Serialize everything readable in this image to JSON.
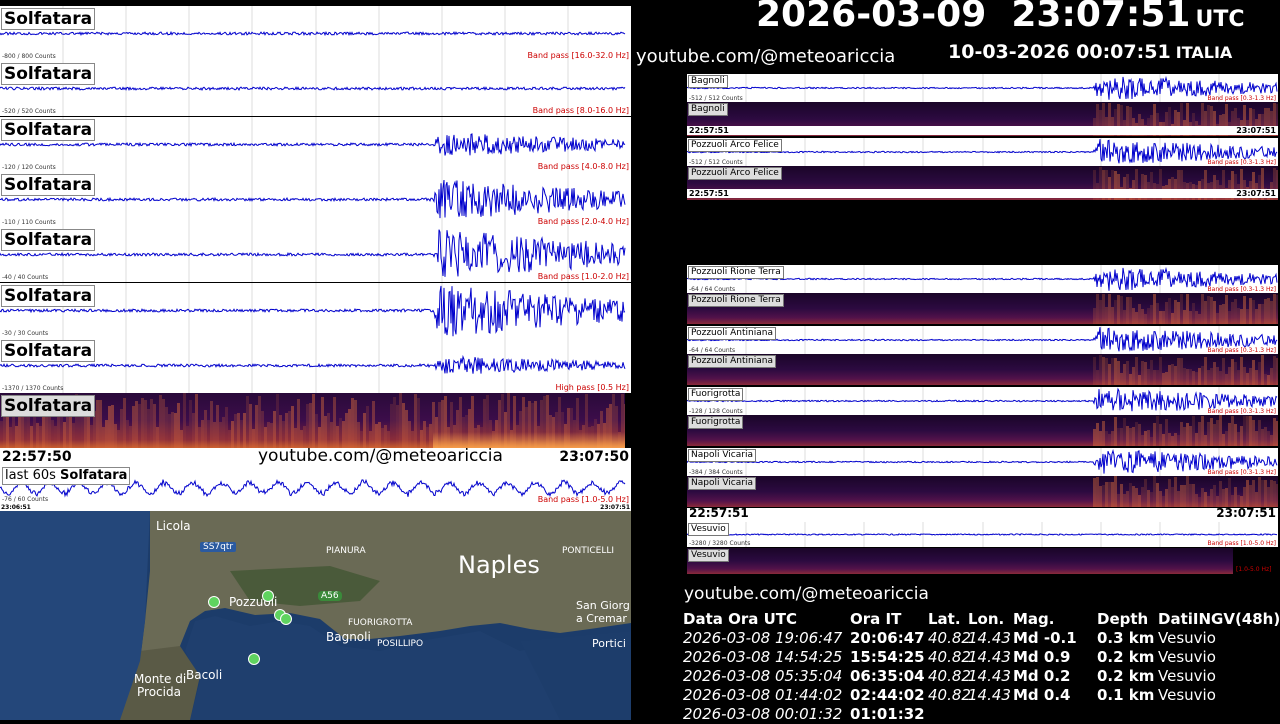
{
  "header": {
    "utc_datetime": "2026-03-09  23:07:51",
    "utc_label": "UTC",
    "local_datetime": "10-03-2026 00:07:51",
    "local_label": "ITALIA",
    "channel": "youtube.com/@meteoariccia"
  },
  "left_panels": [
    {
      "station": "Solfatara",
      "counts": "-800 / 800 Counts",
      "filter": "Band pass [16.0-32.0 Hz]",
      "type": "trace",
      "amp": 0.08
    },
    {
      "station": "Solfatara",
      "counts": "-520 / 520 Counts",
      "filter": "Band pass [8.0-16.0 Hz]",
      "type": "trace",
      "amp": 0.08
    },
    {
      "station": "Solfatara",
      "counts": "-120 / 120 Counts",
      "filter": "Band pass [4.0-8.0 Hz]",
      "type": "trace",
      "amp": 0.45
    },
    {
      "station": "Solfatara",
      "counts": "-110 / 110 Counts",
      "filter": "Band pass [2.0-4.0 Hz]",
      "type": "trace",
      "amp": 0.75
    },
    {
      "station": "Solfatara",
      "counts": "-40 / 40 Counts",
      "filter": "Band pass [1.0-2.0 Hz]",
      "type": "trace",
      "amp": 0.95
    },
    {
      "station": "Solfatara",
      "counts": "-30 / 30 Counts",
      "filter": "",
      "type": "trace",
      "amp": 1.0
    },
    {
      "station": "Solfatara",
      "counts": "-1370 / 1370 Counts",
      "filter": "High pass [0.5 Hz]",
      "type": "trace",
      "amp": 0.35
    },
    {
      "station": "Solfatara",
      "counts": "",
      "filter": "",
      "type": "spectrogram",
      "amp": 0
    }
  ],
  "left_time": {
    "start": "22:57:50",
    "end": "23:07:50",
    "channel": "youtube.com/@meteoariccia"
  },
  "last60": {
    "label": "last 60s",
    "station": "Solfatara",
    "counts": "-76 / 60 Counts",
    "filter": "Band pass [1.0-5.0 Hz]",
    "start": "23:06:51",
    "end": "23:07:51"
  },
  "map": {
    "labels": {
      "licola": "Licola",
      "ss7qtr": "SS7qtr",
      "pianura": "PIANURA",
      "ponticelli": "PONTICELLI",
      "naples": "Naples",
      "pozzuoli": "Pozzuoli",
      "a56": "A56",
      "fuorigrotta": "FUORIGROTTA",
      "san_giorgio": "San Giorg",
      "cremano": "a Cremar",
      "bagnoli": "Bagnoli",
      "posillipo": "POSILLIPO",
      "portici": "Portici",
      "bacoli": "Bacoli",
      "monte_di": "Monte di",
      "procida": "Procida"
    }
  },
  "right_group1": {
    "panels": [
      {
        "station": "Bagnoli",
        "counts": "-512 / 512 Counts",
        "filter": "Band pass [0.3-1.3 Hz]"
      },
      {
        "station": "Pozzuoli Arco Felice",
        "counts": "-512 / 512 Counts",
        "filter": "Band pass [0.3-1.3 Hz]"
      }
    ],
    "start": "22:57:51",
    "end": "23:07:51"
  },
  "right_group2": {
    "panels": [
      {
        "station": "Pozzuoli Rione Terra",
        "counts": "-64 / 64 Counts",
        "filter": "Band pass [0.3-1.3 Hz]"
      },
      {
        "station": "Pozzuoli Antiniana",
        "counts": "-64 / 64 Counts",
        "filter": "Band pass [0.3-1.3 Hz]"
      },
      {
        "station": "Fuorigrotta",
        "counts": "-128 / 128 Counts",
        "filter": "Band pass [0.3-1.3 Hz]"
      },
      {
        "station": "Napoli Vicaria",
        "counts": "-384 / 384 Counts",
        "filter": "Band pass [0.3-1.3 Hz]"
      }
    ],
    "start": "22:57:51",
    "end": "23:07:51"
  },
  "vesuvio": {
    "station": "Vesuvio",
    "counts": "-3280 / 3280 Counts",
    "filter": "Band pass [1.0-5.0 Hz]",
    "spec_filter": "[1.0-5.0 Hz]"
  },
  "table": {
    "channel": "youtube.com/@meteoariccia",
    "headers": [
      "Data Ora UTC",
      "Ora IT",
      "Lat.",
      "Lon.",
      "Mag.",
      "Depth",
      "DatiINGV(48h)"
    ],
    "rows": [
      [
        "2026-03-08 19:06:47",
        "20:06:47",
        "40.82",
        "14.43",
        "Md -0.1",
        "0.3 km",
        "Vesuvio"
      ],
      [
        "2026-03-08 14:54:25",
        "15:54:25",
        "40.82",
        "14.43",
        "Md 0.9",
        "0.2 km",
        "Vesuvio"
      ],
      [
        "2026-03-08 05:35:04",
        "06:35:04",
        "40.82",
        "14.43",
        "Md 0.2",
        "0.2 km",
        "Vesuvio"
      ],
      [
        "2026-03-08 01:44:02",
        "02:44:02",
        "40.82",
        "14.43",
        "Md 0.4",
        "0.1 km",
        "Vesuvio"
      ],
      [
        "2026-03-08 00:01:32",
        "01:01:32",
        "",
        "",
        "",
        "",
        ""
      ]
    ]
  },
  "colors": {
    "trace": "#0000cc",
    "band": "#cc0000",
    "background": "#000000"
  }
}
